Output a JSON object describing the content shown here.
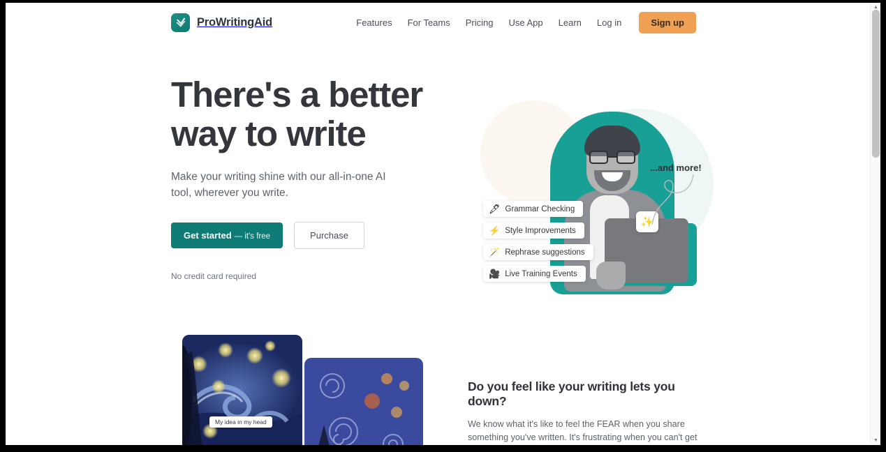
{
  "header": {
    "brand_name": "ProWritingAid",
    "brand_icon": "prowritingaid-logo-icon",
    "nav": [
      {
        "label": "Features"
      },
      {
        "label": "For Teams"
      },
      {
        "label": "Pricing"
      },
      {
        "label": "Use App"
      },
      {
        "label": "Learn"
      },
      {
        "label": "Log in"
      }
    ],
    "signup_label": "Sign up"
  },
  "hero": {
    "title_line_1": "There's a better",
    "title_line_2": "way to write",
    "subtitle": "Make your writing shine with our all-in-one AI tool, wherever you write.",
    "primary_cta": "Get started",
    "primary_cta_note": "— it's free",
    "secondary_cta": "Purchase",
    "no_card_note": "No credit card required",
    "callout": "...and more!",
    "sparkle_icon": "✨",
    "features": [
      {
        "icon": "🖋",
        "icon_name": "pen-icon",
        "label": "Grammar Checking"
      },
      {
        "icon": "⚡",
        "icon_name": "lightning-icon",
        "label": "Style Improvements"
      },
      {
        "icon": "🪄",
        "icon_name": "magic-wand-icon",
        "label": "Rephrase suggestions"
      },
      {
        "icon": "🎥",
        "icon_name": "video-camera-icon",
        "label": "Live Training Events"
      }
    ]
  },
  "section_two": {
    "title": "Do you feel like your writing lets you down?",
    "body": "We know what it's like to feel the FEAR when you share something you've written. It's frustrating when you can't get your writing to do your ideas justice.",
    "art_caption": "My idea in my head"
  },
  "scrollbar": {
    "up_arrow": "▲",
    "down_arrow": "▼"
  },
  "colors": {
    "brand_teal": "#0e7c74",
    "accent_orange": "#efa052",
    "text_dark": "#33363b",
    "text_muted": "#5d636b"
  }
}
